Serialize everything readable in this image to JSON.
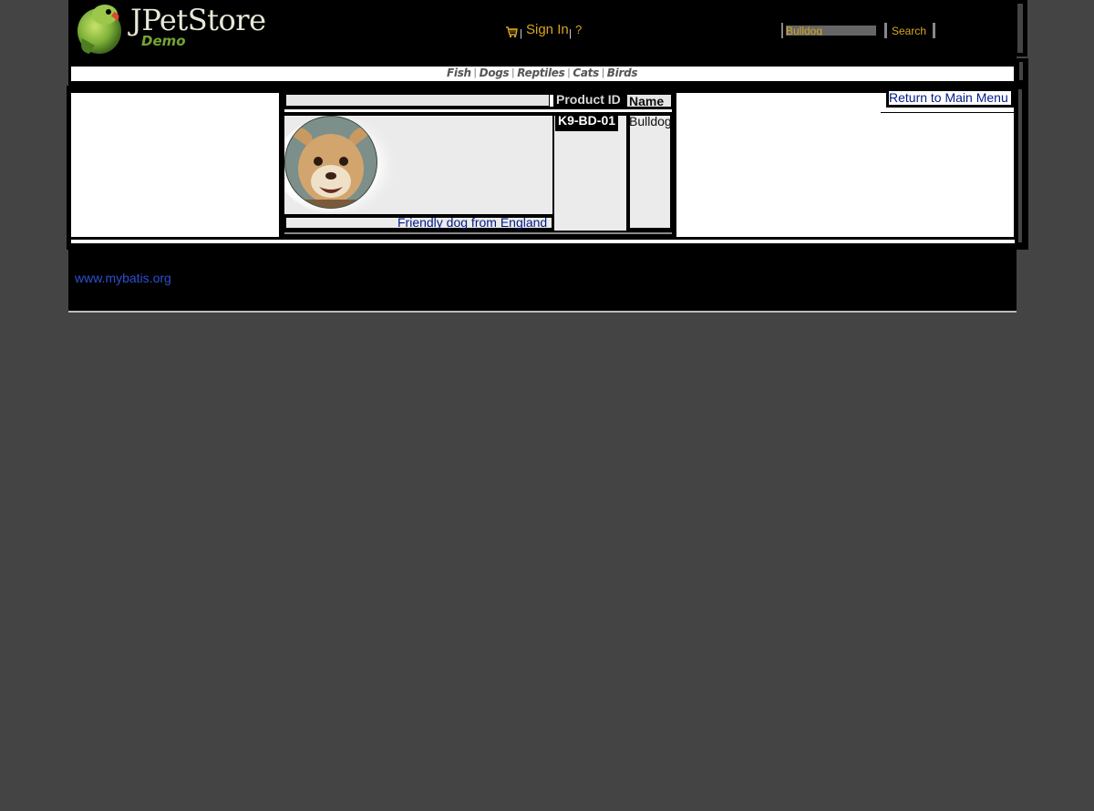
{
  "header": {
    "logo": {
      "title": "JPetStore",
      "subtitle": "Demo",
      "icon": "parrot-logo-icon"
    },
    "cart_icon": "cart-icon",
    "separator": "|",
    "sign_in_label": "Sign In",
    "help_label": "?",
    "search": {
      "value": "Bulldog",
      "button_label": "Search"
    }
  },
  "categories": {
    "separator": "|",
    "items": [
      {
        "label": "Fish"
      },
      {
        "label": "Dogs"
      },
      {
        "label": "Reptiles"
      },
      {
        "label": "Cats"
      },
      {
        "label": "Birds"
      }
    ]
  },
  "sidebar": {
    "return_label": "Return to Main Menu"
  },
  "product_table": {
    "headers": {
      "image": "",
      "product_id": "Product ID",
      "name": "Name"
    },
    "rows": [
      {
        "image_icon": "dog-photo",
        "description": "Friendly dog from England",
        "product_id": "K9-BD-01",
        "name": "Bulldog"
      }
    ]
  },
  "footer": {
    "link": "www.mybatis.org"
  },
  "colors": {
    "background": "#444444",
    "frame": "#000000",
    "accent": "#d7a520",
    "link": "#001a8a",
    "footer_link": "#2d4fd0"
  }
}
